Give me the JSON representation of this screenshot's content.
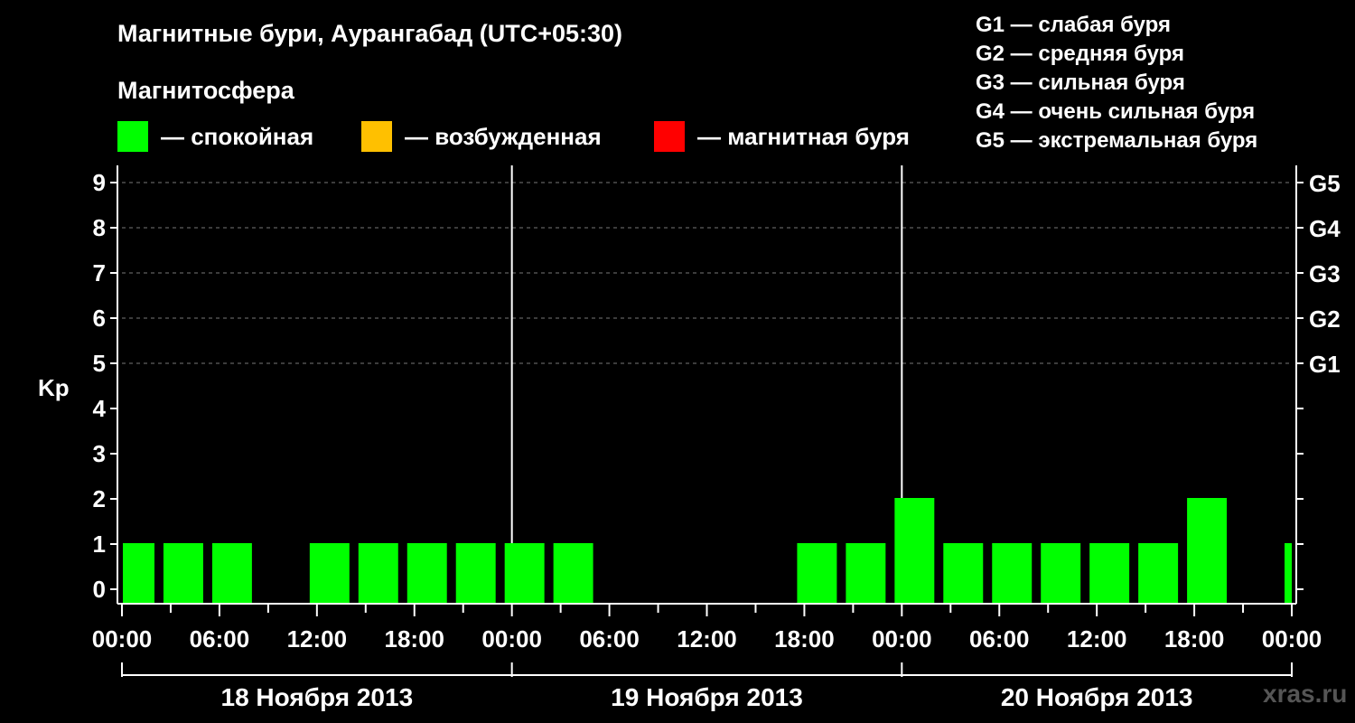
{
  "title": "Магнитные бури, Аурангабад (UTC+05:30)",
  "subtitle": "Магнитосфера",
  "legend": [
    {
      "label": "— спокойная",
      "color": "#00ff00"
    },
    {
      "label": "— возбужденная",
      "color": "#ffc000"
    },
    {
      "label": "— магнитная буря",
      "color": "#ff0000"
    }
  ],
  "g_scale": [
    "G1 — слабая буря",
    "G2 — средняя буря",
    "G3 — сильная буря",
    "G4 — очень сильная буря",
    "G5 — экстремальная буря"
  ],
  "watermark": "xras.ru",
  "colors": {
    "quiet": "#00ff00",
    "background": "#000000",
    "axis": "#ffffff"
  },
  "chart_data": {
    "type": "bar",
    "ylabel": "Kp",
    "ylim": [
      0,
      9
    ],
    "yticks": [
      "0",
      "1",
      "2",
      "3",
      "4",
      "5",
      "6",
      "7",
      "8",
      "9"
    ],
    "right_ticks": [
      {
        "kp": 5,
        "label": "G1"
      },
      {
        "kp": 6,
        "label": "G2"
      },
      {
        "kp": 7,
        "label": "G3"
      },
      {
        "kp": 8,
        "label": "G4"
      },
      {
        "kp": 9,
        "label": "G5"
      }
    ],
    "grid": "dashed horizontal at Kp 5–9",
    "x_tick_labels": [
      "00:00",
      "06:00",
      "12:00",
      "18:00",
      "00:00",
      "06:00",
      "12:00",
      "18:00",
      "00:00",
      "06:00",
      "12:00",
      "18:00",
      "00:00"
    ],
    "days": [
      "18 Ноября 2013",
      "19 Ноября 2013",
      "20 Ноября 2013"
    ],
    "bars": [
      {
        "start": "18.11 00:00",
        "end": "18.11 02:00",
        "kp": 1
      },
      {
        "start": "18.11 02:30",
        "end": "18.11 05:00",
        "kp": 1
      },
      {
        "start": "18.11 05:30",
        "end": "18.11 08:00",
        "kp": 1
      },
      {
        "start": "18.11 11:30",
        "end": "18.11 14:00",
        "kp": 1
      },
      {
        "start": "18.11 14:30",
        "end": "18.11 17:00",
        "kp": 1
      },
      {
        "start": "18.11 17:30",
        "end": "18.11 20:00",
        "kp": 1
      },
      {
        "start": "18.11 20:30",
        "end": "18.11 23:00",
        "kp": 1
      },
      {
        "start": "18.11 23:30",
        "end": "19.11 02:00",
        "kp": 1
      },
      {
        "start": "19.11 02:30",
        "end": "19.11 05:00",
        "kp": 1
      },
      {
        "start": "19.11 17:30",
        "end": "19.11 20:00",
        "kp": 1
      },
      {
        "start": "19.11 20:30",
        "end": "19.11 23:00",
        "kp": 1
      },
      {
        "start": "19.11 23:30",
        "end": "20.11 02:00",
        "kp": 2
      },
      {
        "start": "20.11 02:30",
        "end": "20.11 05:00",
        "kp": 1
      },
      {
        "start": "20.11 05:30",
        "end": "20.11 08:00",
        "kp": 1
      },
      {
        "start": "20.11 08:30",
        "end": "20.11 11:00",
        "kp": 1
      },
      {
        "start": "20.11 11:30",
        "end": "20.11 14:00",
        "kp": 1
      },
      {
        "start": "20.11 14:30",
        "end": "20.11 17:00",
        "kp": 1
      },
      {
        "start": "20.11 17:30",
        "end": "20.11 20:00",
        "kp": 2
      },
      {
        "start": "20.11 23:30",
        "end": "21.11 00:00",
        "kp": 1
      }
    ]
  }
}
